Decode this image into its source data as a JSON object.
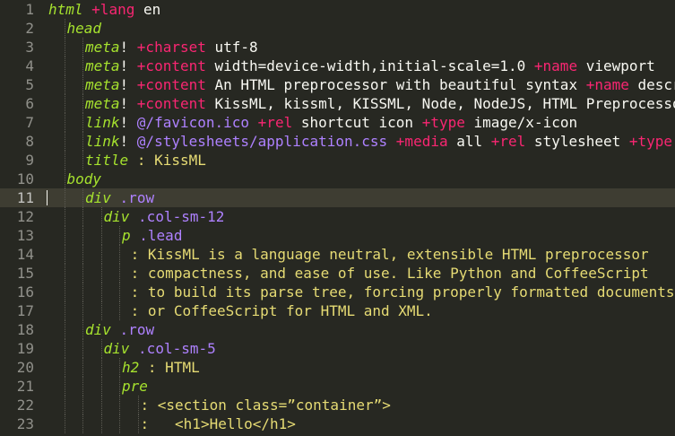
{
  "editor": {
    "theme": {
      "background": "#272822",
      "current_line": "#3e3d32",
      "gutter_text": "#90908a",
      "tag": "#a6e22e",
      "keyword": "#f92672",
      "class": "#ae81ff",
      "plain": "#f8f8f2",
      "string": "#e6db74"
    },
    "current_line_number": 11,
    "lines": [
      {
        "n": 1,
        "indent": 0,
        "tokens": [
          {
            "t": "tag",
            "v": "html"
          },
          {
            "t": "plain",
            "v": " "
          },
          {
            "t": "kw",
            "v": "+lang"
          },
          {
            "t": "plain",
            "v": " en"
          }
        ]
      },
      {
        "n": 2,
        "indent": 1,
        "tokens": [
          {
            "t": "tag",
            "v": "head"
          }
        ]
      },
      {
        "n": 3,
        "indent": 2,
        "tokens": [
          {
            "t": "tag",
            "v": "meta"
          },
          {
            "t": "plain",
            "v": "! "
          },
          {
            "t": "kw",
            "v": "+charset"
          },
          {
            "t": "plain",
            "v": " utf-8"
          }
        ]
      },
      {
        "n": 4,
        "indent": 2,
        "tokens": [
          {
            "t": "tag",
            "v": "meta"
          },
          {
            "t": "plain",
            "v": "! "
          },
          {
            "t": "kw",
            "v": "+content"
          },
          {
            "t": "plain",
            "v": " width=device-width,initial-scale=1.0 "
          },
          {
            "t": "kw",
            "v": "+name"
          },
          {
            "t": "plain",
            "v": " viewport"
          }
        ]
      },
      {
        "n": 5,
        "indent": 2,
        "tokens": [
          {
            "t": "tag",
            "v": "meta"
          },
          {
            "t": "plain",
            "v": "! "
          },
          {
            "t": "kw",
            "v": "+content"
          },
          {
            "t": "plain",
            "v": " An HTML preprocessor with beautiful syntax "
          },
          {
            "t": "kw",
            "v": "+name"
          },
          {
            "t": "plain",
            "v": " description"
          }
        ]
      },
      {
        "n": 6,
        "indent": 2,
        "tokens": [
          {
            "t": "tag",
            "v": "meta"
          },
          {
            "t": "plain",
            "v": "! "
          },
          {
            "t": "kw",
            "v": "+content"
          },
          {
            "t": "plain",
            "v": " KissML, kissml, KISSML, Node, NodeJS, HTML Preprocessor"
          }
        ]
      },
      {
        "n": 7,
        "indent": 2,
        "tokens": [
          {
            "t": "tag",
            "v": "link"
          },
          {
            "t": "plain",
            "v": "! "
          },
          {
            "t": "cls",
            "v": "@/favicon.ico"
          },
          {
            "t": "plain",
            "v": " "
          },
          {
            "t": "kw",
            "v": "+rel"
          },
          {
            "t": "plain",
            "v": " shortcut icon "
          },
          {
            "t": "kw",
            "v": "+type"
          },
          {
            "t": "plain",
            "v": " image/x-icon"
          }
        ]
      },
      {
        "n": 8,
        "indent": 2,
        "tokens": [
          {
            "t": "tag",
            "v": "link"
          },
          {
            "t": "plain",
            "v": "! "
          },
          {
            "t": "cls",
            "v": "@/stylesheets/application.css"
          },
          {
            "t": "plain",
            "v": " "
          },
          {
            "t": "kw",
            "v": "+media"
          },
          {
            "t": "plain",
            "v": " all "
          },
          {
            "t": "kw",
            "v": "+rel"
          },
          {
            "t": "plain",
            "v": " stylesheet "
          },
          {
            "t": "kw",
            "v": "+type"
          }
        ]
      },
      {
        "n": 9,
        "indent": 2,
        "tokens": [
          {
            "t": "tag",
            "v": "title"
          },
          {
            "t": "plain",
            "v": " "
          },
          {
            "t": "pipe",
            "v": ":"
          },
          {
            "t": "text",
            "v": " KissML"
          }
        ]
      },
      {
        "n": 10,
        "indent": 1,
        "tokens": [
          {
            "t": "tag",
            "v": "body"
          }
        ]
      },
      {
        "n": 11,
        "indent": 2,
        "tokens": [
          {
            "t": "tag",
            "v": "div"
          },
          {
            "t": "plain",
            "v": " "
          },
          {
            "t": "cls",
            "v": ".row"
          }
        ]
      },
      {
        "n": 12,
        "indent": 3,
        "tokens": [
          {
            "t": "tag",
            "v": "div"
          },
          {
            "t": "plain",
            "v": " "
          },
          {
            "t": "cls",
            "v": ".col-sm-12"
          }
        ]
      },
      {
        "n": 13,
        "indent": 4,
        "tokens": [
          {
            "t": "tag",
            "v": "p"
          },
          {
            "t": "plain",
            "v": " "
          },
          {
            "t": "cls",
            "v": ".lead"
          }
        ]
      },
      {
        "n": 14,
        "indent": 4,
        "tokens": [
          {
            "t": "plain",
            "v": " "
          },
          {
            "t": "pipe",
            "v": ":"
          },
          {
            "t": "text",
            "v": " KissML is a language neutral, extensible HTML preprocessor"
          }
        ]
      },
      {
        "n": 15,
        "indent": 4,
        "tokens": [
          {
            "t": "plain",
            "v": " "
          },
          {
            "t": "pipe",
            "v": ":"
          },
          {
            "t": "text",
            "v": " compactness, and ease of use. Like Python and CoffeeScript"
          }
        ]
      },
      {
        "n": 16,
        "indent": 4,
        "tokens": [
          {
            "t": "plain",
            "v": " "
          },
          {
            "t": "pipe",
            "v": ":"
          },
          {
            "t": "text",
            "v": " to build its parse tree, forcing properly formatted documents"
          }
        ]
      },
      {
        "n": 17,
        "indent": 4,
        "tokens": [
          {
            "t": "plain",
            "v": " "
          },
          {
            "t": "pipe",
            "v": ":"
          },
          {
            "t": "text",
            "v": " or CoffeeScript for HTML and XML."
          }
        ]
      },
      {
        "n": 18,
        "indent": 2,
        "tokens": [
          {
            "t": "tag",
            "v": "div"
          },
          {
            "t": "plain",
            "v": " "
          },
          {
            "t": "cls",
            "v": ".row"
          }
        ]
      },
      {
        "n": 19,
        "indent": 3,
        "tokens": [
          {
            "t": "tag",
            "v": "div"
          },
          {
            "t": "plain",
            "v": " "
          },
          {
            "t": "cls",
            "v": ".col-sm-5"
          }
        ]
      },
      {
        "n": 20,
        "indent": 4,
        "tokens": [
          {
            "t": "tag",
            "v": "h2"
          },
          {
            "t": "plain",
            "v": " "
          },
          {
            "t": "pipe",
            "v": ":"
          },
          {
            "t": "text",
            "v": " HTML"
          }
        ]
      },
      {
        "n": 21,
        "indent": 4,
        "tokens": [
          {
            "t": "tag",
            "v": "pre"
          }
        ]
      },
      {
        "n": 22,
        "indent": 5,
        "tokens": [
          {
            "t": "pipe",
            "v": ":"
          },
          {
            "t": "text",
            "v": " <section class=”container”>"
          }
        ]
      },
      {
        "n": 23,
        "indent": 5,
        "tokens": [
          {
            "t": "pipe",
            "v": ":"
          },
          {
            "t": "text",
            "v": "   <h1>Hello</h1>"
          }
        ]
      }
    ]
  }
}
